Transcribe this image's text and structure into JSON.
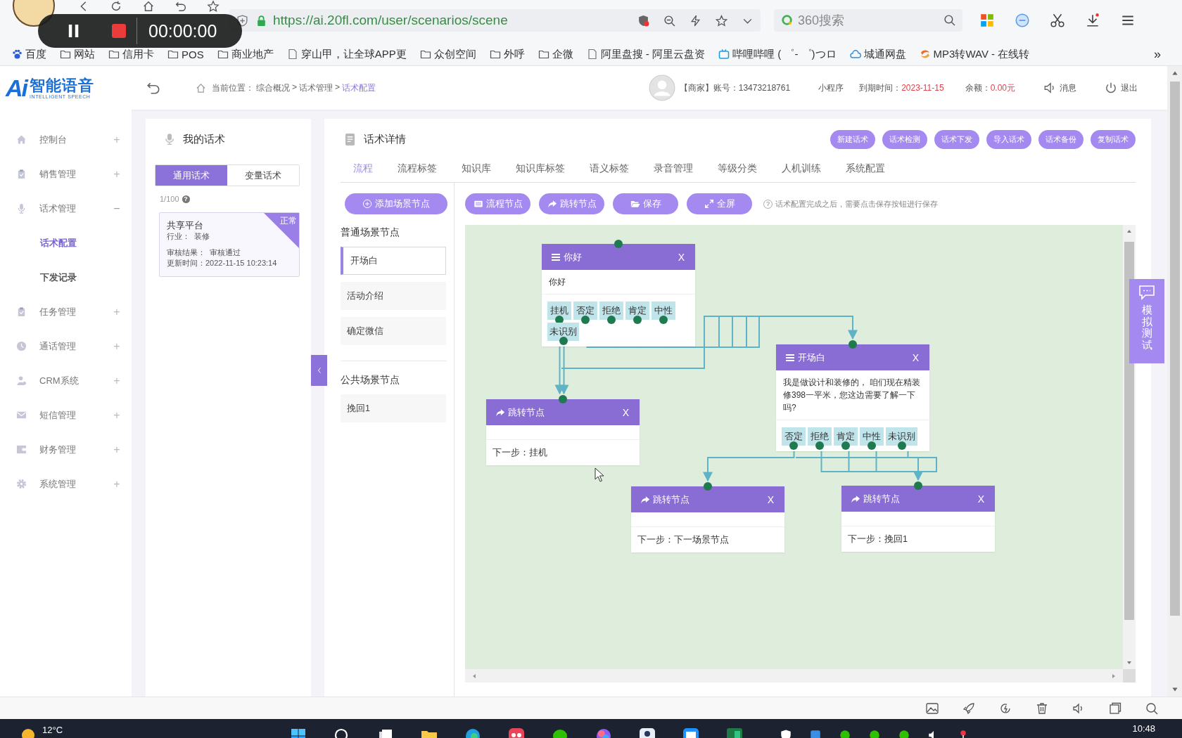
{
  "recorder": {
    "timer": "00:00:00"
  },
  "browser": {
    "url": "https://ai.20fl.com/user/scenarios/scene",
    "search_placeholder": "360搜索",
    "more": "»",
    "bookmarks": [
      {
        "label": "百度",
        "kind": "paw"
      },
      {
        "label": "网站",
        "kind": "folder"
      },
      {
        "label": "信用卡",
        "kind": "folder"
      },
      {
        "label": "POS",
        "kind": "folder"
      },
      {
        "label": "商业地产",
        "kind": "folder"
      },
      {
        "label": "穿山甲，让全球APP更",
        "kind": "page"
      },
      {
        "label": "众创空间",
        "kind": "folder"
      },
      {
        "label": "外呼",
        "kind": "folder"
      },
      {
        "label": "企微",
        "kind": "folder"
      },
      {
        "label": "阿里盘搜 - 阿里云盘资",
        "kind": "page"
      },
      {
        "label": "哔哩哔哩 ( ゜- ゜)つロ",
        "kind": "tv"
      },
      {
        "label": "城通网盘",
        "kind": "cloud"
      },
      {
        "label": "MP3转WAV - 在线转",
        "kind": "swirl"
      }
    ]
  },
  "header": {
    "logo": {
      "mark": "Ai",
      "name": "智能语音",
      "tagline": "INTELLIGENT SPEECH"
    },
    "breadcrumb": [
      {
        "text": "当前位置：",
        "kind": "prefix"
      },
      {
        "text": "综合概况",
        "kind": "link"
      },
      {
        "text": ">",
        "kind": "separator"
      },
      {
        "text": "话术管理",
        "kind": "link"
      },
      {
        "text": ">",
        "kind": "separator"
      },
      {
        "text": "话术配置",
        "kind": "current"
      }
    ],
    "account": "【商家】账号：13473218761",
    "mini_program": "小程序",
    "expiry_label": "到期时间：",
    "expiry": "2023-11-15",
    "balance_label": "余额：",
    "balance": "0.00元",
    "messages": "消息",
    "logout": "退出"
  },
  "sidebar": {
    "items": [
      {
        "label": "控制台",
        "kind": "home",
        "toggle": "+",
        "expanded": false
      },
      {
        "label": "销售管理",
        "kind": "clipboard",
        "toggle": "+",
        "expanded": false
      },
      {
        "label": "话术管理",
        "kind": "mic",
        "toggle": "−",
        "expanded": true,
        "children": [
          {
            "label": "话术配置",
            "selected": true
          },
          {
            "label": "下发记录",
            "selected": false
          }
        ]
      },
      {
        "label": "任务管理",
        "kind": "clipboard",
        "toggle": "+",
        "expanded": false
      },
      {
        "label": "通话管理",
        "kind": "clock",
        "toggle": "+",
        "expanded": false
      },
      {
        "label": "CRM系统",
        "kind": "person",
        "toggle": "+",
        "expanded": false
      },
      {
        "label": "短信管理",
        "kind": "mail",
        "toggle": "+",
        "expanded": false
      },
      {
        "label": "财务管理",
        "kind": "card",
        "toggle": "+",
        "expanded": false
      },
      {
        "label": "系统管理",
        "kind": "gear",
        "toggle": "+",
        "expanded": false
      }
    ]
  },
  "scripts_panel": {
    "title": "我的话术",
    "tabs": [
      {
        "label": "通用话术",
        "selected": true
      },
      {
        "label": "变量话术",
        "selected": false
      }
    ],
    "count": "1/100",
    "count_help": "?",
    "cards": [
      {
        "name": "共享平台",
        "industry": "行业：  装修",
        "status": "正常",
        "review": "审核结果：  审核通过",
        "updated": "更新时间：2022-11-15 10:23:14"
      }
    ]
  },
  "detail": {
    "title": "话术详情",
    "actions": [
      "新建话术",
      "话术检测",
      "话术下发",
      "导入话术",
      "话术备份",
      "复制话术"
    ],
    "tabs": [
      {
        "label": "流程",
        "selected": true
      },
      {
        "label": "流程标签",
        "selected": false
      },
      {
        "label": "知识库",
        "selected": false
      },
      {
        "label": "知识库标签",
        "selected": false
      },
      {
        "label": "语义标签",
        "selected": false
      },
      {
        "label": "录音管理",
        "selected": false
      },
      {
        "label": "等级分类",
        "selected": false
      },
      {
        "label": "人机训练",
        "selected": false
      },
      {
        "label": "系统配置",
        "selected": false
      }
    ],
    "add_scene": "添加场景节点",
    "toolbar": [
      {
        "label": "流程节点",
        "kind": "list"
      },
      {
        "label": "跳转节点",
        "kind": "share"
      },
      {
        "label": "保存",
        "kind": "folder"
      },
      {
        "label": "全屏",
        "kind": "expand"
      }
    ],
    "hint_mark": "?",
    "hint": "话术配置完成之后，需要点击保存按钮进行保存",
    "scene_groups": [
      {
        "title": "普通场景节点",
        "items": [
          {
            "label": "开场白",
            "selected": true
          },
          {
            "label": "活动介绍",
            "selected": false
          },
          {
            "label": "确定微信",
            "selected": false
          }
        ]
      },
      {
        "title": "公共场景节点",
        "items": [
          {
            "label": "挽回1",
            "selected": false
          }
        ]
      }
    ],
    "nodes": [
      {
        "kind": "flow",
        "title": "你好",
        "close": "X",
        "text": "你好",
        "options": [
          "挂机",
          "否定",
          "拒绝",
          "肯定",
          "中性",
          "未识别"
        ]
      },
      {
        "kind": "flow",
        "title": "开场白",
        "close": "X",
        "text": "我是做设计和装修的， 咱们现在精装修398一平米，您这边需要了解一下吗?",
        "options": [
          "否定",
          "拒绝",
          "肯定",
          "中性",
          "未识别"
        ]
      },
      {
        "kind": "jump",
        "title": "跳转节点",
        "close": "X",
        "next": "下一步：挂机"
      },
      {
        "kind": "jump",
        "title": "跳转节点",
        "close": "X",
        "next": "下一步：下一场景节点"
      },
      {
        "kind": "jump",
        "title": "跳转节点",
        "close": "X",
        "next": "下一步：挽回1"
      }
    ]
  },
  "simulate_tab": {
    "label": "模拟测试"
  },
  "taskbar": {
    "weather": "12°C",
    "time": "10:48"
  }
}
